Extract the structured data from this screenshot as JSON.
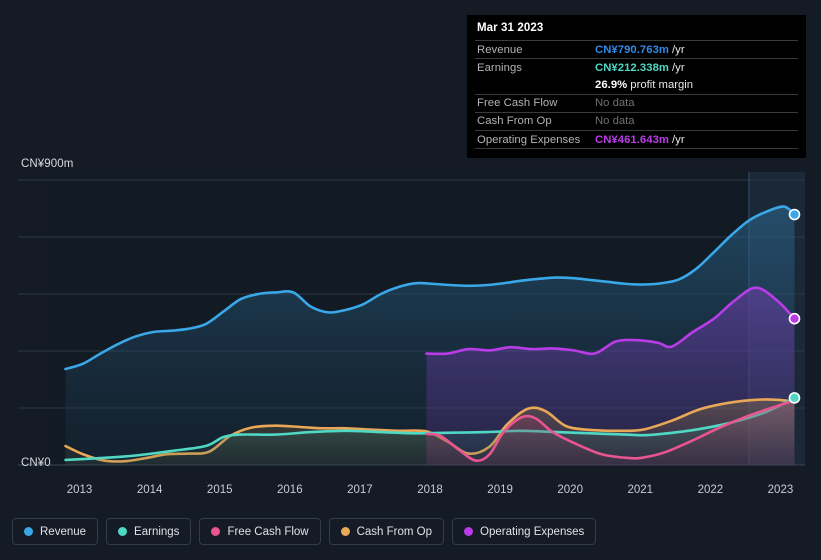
{
  "chart_data": {
    "type": "area",
    "title": "",
    "xlabel": "",
    "ylabel": "",
    "currency": "CN¥",
    "y_top_label": "CN¥900m",
    "y_zero_label": "CN¥0",
    "ylim": [
      0,
      900
    ],
    "xlim": [
      2012.6,
      2023.4
    ],
    "grid": true,
    "gridlines": [
      0,
      180,
      360,
      540,
      720,
      900
    ],
    "legend_position": "bottom-left",
    "x_ticks": [
      "2013",
      "2014",
      "2015",
      "2016",
      "2017",
      "2018",
      "2019",
      "2020",
      "2021",
      "2022",
      "2023"
    ],
    "forecast_band_start": "2022.6",
    "series": [
      {
        "name": "Revenue",
        "color": "#39a7e8",
        "x": [
          2012.85,
          2013.1,
          2013.35,
          2013.6,
          2013.85,
          2014.1,
          2014.35,
          2014.6,
          2014.85,
          2015.1,
          2015.35,
          2015.6,
          2015.85,
          2016.1,
          2016.35,
          2016.6,
          2016.85,
          2017.1,
          2017.35,
          2017.6,
          2017.85,
          2018.1,
          2018.35,
          2018.6,
          2018.85,
          2019.1,
          2019.35,
          2019.6,
          2019.85,
          2020.1,
          2020.35,
          2020.6,
          2020.85,
          2021.1,
          2021.35,
          2021.6,
          2021.85,
          2022.1,
          2022.35,
          2022.6,
          2022.85,
          2023.1,
          2023.25
        ],
        "values": [
          303,
          320,
          352,
          382,
          406,
          420,
          424,
          430,
          445,
          484,
          524,
          540,
          545,
          545,
          500,
          482,
          490,
          508,
          540,
          562,
          574,
          572,
          568,
          566,
          568,
          574,
          582,
          588,
          592,
          590,
          584,
          578,
          572,
          570,
          574,
          586,
          620,
          672,
          726,
          772,
          800,
          816,
          791
        ],
        "end_value_label": "CN¥790.763m"
      },
      {
        "name": "Earnings",
        "color": "#4fd8c4",
        "x": [
          2012.85,
          2013.35,
          2013.85,
          2014.35,
          2014.85,
          2015.1,
          2015.35,
          2015.85,
          2016.35,
          2016.85,
          2017.35,
          2017.85,
          2018.35,
          2018.85,
          2019.35,
          2019.85,
          2020.35,
          2020.85,
          2021.1,
          2021.35,
          2021.85,
          2022.35,
          2022.85,
          2023.25
        ],
        "values": [
          16,
          22,
          30,
          44,
          60,
          88,
          96,
          96,
          104,
          108,
          104,
          100,
          102,
          104,
          108,
          104,
          100,
          96,
          94,
          98,
          112,
          134,
          168,
          212
        ],
        "end_value_label": "CN¥212.338m"
      },
      {
        "name": "Free Cash Flow",
        "color": "#e8558f",
        "x": [
          2018.0,
          2018.2,
          2018.45,
          2018.7,
          2018.9,
          2019.1,
          2019.35,
          2019.55,
          2019.8,
          2020.1,
          2020.5,
          2020.9,
          2021.1,
          2021.4,
          2021.8,
          2022.2,
          2022.6,
          2023.0,
          2023.25
        ],
        "values": [
          98,
          92,
          50,
          14,
          34,
          104,
          150,
          148,
          104,
          70,
          34,
          22,
          24,
          40,
          78,
          120,
          156,
          186,
          204
        ],
        "end_value_label": "No data"
      },
      {
        "name": "Cash From Op",
        "color": "#e8a857",
        "x": [
          2012.85,
          2013.1,
          2013.4,
          2013.7,
          2014.0,
          2014.3,
          2014.6,
          2014.9,
          2015.2,
          2015.5,
          2015.85,
          2016.2,
          2016.5,
          2016.85,
          2017.2,
          2017.6,
          2018.0,
          2018.3,
          2018.6,
          2018.9,
          2019.15,
          2019.45,
          2019.7,
          2020.0,
          2020.4,
          2020.8,
          2021.1,
          2021.5,
          2021.9,
          2022.3,
          2022.7,
          2023.0,
          2023.25
        ],
        "values": [
          60,
          34,
          14,
          12,
          22,
          34,
          36,
          42,
          92,
          118,
          124,
          120,
          116,
          116,
          112,
          108,
          106,
          74,
          36,
          58,
          128,
          178,
          170,
          122,
          110,
          108,
          112,
          140,
          176,
          196,
          206,
          206,
          200
        ],
        "end_value_label": "No data"
      },
      {
        "name": "Operating Expenses",
        "color": "#b93ce8",
        "x": [
          2018.0,
          2018.3,
          2018.6,
          2018.9,
          2019.2,
          2019.5,
          2019.8,
          2020.1,
          2020.4,
          2020.7,
          2021.0,
          2021.3,
          2021.5,
          2021.8,
          2022.1,
          2022.4,
          2022.7,
          2023.0,
          2023.25
        ],
        "values": [
          352,
          352,
          366,
          362,
          372,
          366,
          368,
          362,
          352,
          390,
          394,
          386,
          374,
          420,
          462,
          520,
          560,
          520,
          462
        ],
        "end_value_label": "CN¥461.643m"
      }
    ]
  },
  "tooltip": {
    "date": "Mar 31 2023",
    "rows": [
      {
        "label": "Revenue",
        "value": "CN¥790.763m",
        "unit": "/yr",
        "color": "#2f8ae8",
        "no_data": false
      },
      {
        "label": "Earnings",
        "value": "CN¥212.338m",
        "unit": "/yr",
        "color": "#4fd8c4",
        "no_data": false
      },
      {
        "label": "",
        "value": "26.9%",
        "unit": "profit margin",
        "color": "#ffffff",
        "no_data": false
      },
      {
        "label": "Free Cash Flow",
        "value": "No data",
        "unit": "",
        "color": "#707070",
        "no_data": true
      },
      {
        "label": "Cash From Op",
        "value": "No data",
        "unit": "",
        "color": "#707070",
        "no_data": true
      },
      {
        "label": "Operating Expenses",
        "value": "CN¥461.643m",
        "unit": "/yr",
        "color": "#b93ce8",
        "no_data": false
      }
    ]
  },
  "legend": {
    "items": [
      {
        "label": "Revenue",
        "color": "#39a7e8"
      },
      {
        "label": "Earnings",
        "color": "#4fd8c4"
      },
      {
        "label": "Free Cash Flow",
        "color": "#e8558f"
      },
      {
        "label": "Cash From Op",
        "color": "#e8a857"
      },
      {
        "label": "Operating Expenses",
        "color": "#b93ce8"
      }
    ]
  },
  "axis": {
    "y_top": "CN¥900m",
    "y_zero": "CN¥0",
    "x_ticks": [
      "2013",
      "2014",
      "2015",
      "2016",
      "2017",
      "2018",
      "2019",
      "2020",
      "2021",
      "2022",
      "2023"
    ]
  }
}
